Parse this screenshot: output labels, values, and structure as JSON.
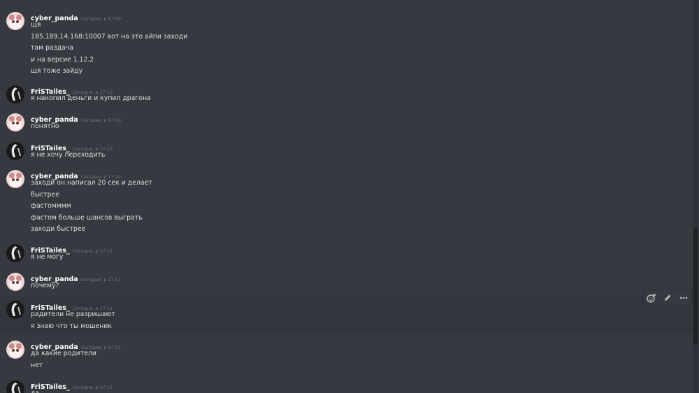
{
  "messages": [
    {
      "author": "cyber_panda",
      "avatar": "panda",
      "time": "Сегодня, в 17:09",
      "lines": [
        "щя",
        "185.189.14.168:10007 вот на это айпи заходи",
        "там раздача",
        "и на версие 1.12.2",
        "щя тоже зайду"
      ]
    },
    {
      "author": "FriSTailes_",
      "avatar": "dark",
      "time": "Сегодня, в 17:10",
      "lines": [
        "я накопил деньги и купил драгона"
      ]
    },
    {
      "author": "cyber_panda",
      "avatar": "panda",
      "time": "Сегодня, в 17:10",
      "lines": [
        "понятно"
      ]
    },
    {
      "author": "FriSTailes_",
      "avatar": "dark",
      "time": "Сегодня, в 17:10",
      "lines": [
        "я не хочу переходить"
      ]
    },
    {
      "author": "cyber_panda",
      "avatar": "panda",
      "time": "Сегодня, в 17:10",
      "lines": [
        "заходи он написал 20 сек и делает",
        "быстрее",
        "фастомммм",
        "фастом больше шансов выграть",
        "заходи быстрее"
      ]
    },
    {
      "author": "FriSTailes_",
      "avatar": "dark",
      "time": "Сегодня, в 17:11",
      "lines": [
        "я не могу"
      ]
    },
    {
      "author": "cyber_panda",
      "avatar": "panda",
      "time": "Сегодня, в 17:11",
      "lines": [
        "почему?"
      ]
    },
    {
      "author": "FriSTailes_",
      "avatar": "dark",
      "time": "Сегодня, в 17:11",
      "lines": [
        "радители не разришают",
        "я знаю что ты мошеник"
      ]
    },
    {
      "author": "cyber_panda",
      "avatar": "panda",
      "time": "Сегодня, в 17:11",
      "lines": [
        "да какие родители",
        "нет"
      ]
    },
    {
      "author": "FriSTailes_",
      "avatar": "dark",
      "time": "Сегодня, в 17:11",
      "lines": [
        "да"
      ]
    }
  ],
  "toolbar": {
    "buttons": [
      "add-reaction-icon",
      "edit-icon",
      "more-icon"
    ]
  },
  "colors": {
    "background": "#36393f",
    "username": "#ffffff",
    "text": "#dcddde",
    "timestamp": "#72767d"
  }
}
